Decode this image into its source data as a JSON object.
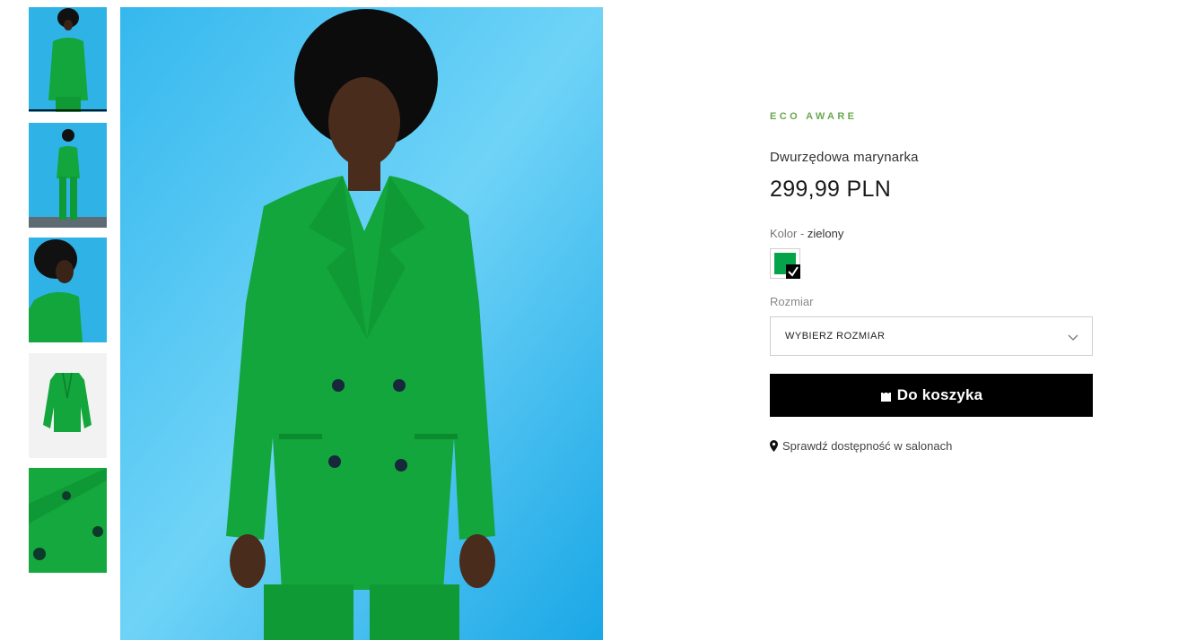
{
  "thumbnails": [
    {
      "name": "thumbnail-front-view",
      "active": true
    },
    {
      "name": "thumbnail-full-body",
      "active": false
    },
    {
      "name": "thumbnail-profile",
      "active": false
    },
    {
      "name": "thumbnail-packshot",
      "active": false
    },
    {
      "name": "thumbnail-fabric-detail",
      "active": false
    }
  ],
  "product": {
    "badge": "ECO AWARE",
    "name": "Dwurzędowa marynarka",
    "price": "299,99 PLN",
    "color_label": "Kolor - ",
    "color_value": "zielony",
    "swatch_color": "#06a44a",
    "size_label": "Rozmiar",
    "size_placeholder": "WYBIERZ ROZMIAR",
    "cart_button": "Do koszyka",
    "store_link": "Sprawdź dostępność w salonach"
  },
  "colors": {
    "eco_badge": "#6aa84f",
    "background_blue": "#29b6ee",
    "jacket_green": "#0fa63a",
    "button_black": "#000000"
  },
  "icons": {
    "cart": "shopping-bag-icon",
    "store": "map-pin-icon",
    "select": "chevron-down-icon",
    "swatch_selected": "checkmark-icon"
  }
}
